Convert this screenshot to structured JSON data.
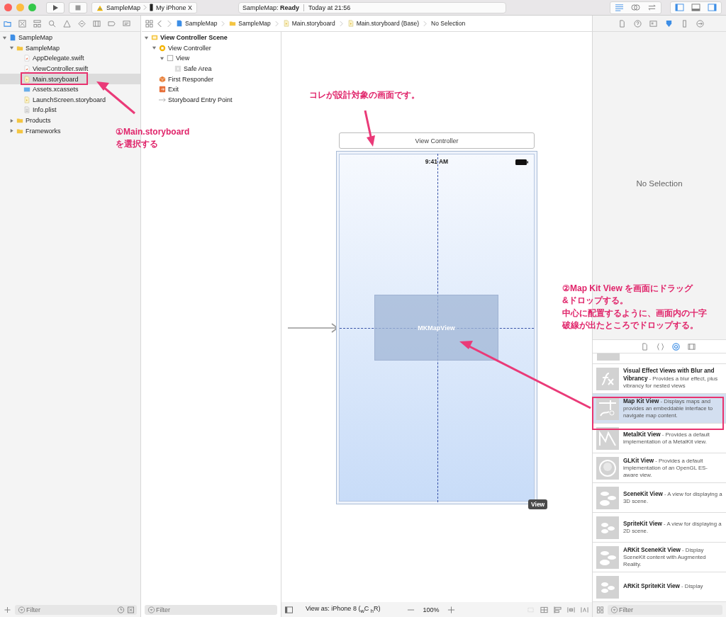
{
  "toolbar": {
    "scheme": "SampleMap",
    "device": "My iPhone X",
    "status": "SampleMap: **Ready**",
    "time": "Today at 21:56"
  },
  "jump_bar": [
    {
      "kind": "project",
      "label": "SampleMap"
    },
    {
      "kind": "folder",
      "label": "SampleMap"
    },
    {
      "kind": "storyboard",
      "label": "Main.storyboard"
    },
    {
      "kind": "storyboard",
      "label": "Main.storyboard (Base)"
    },
    {
      "kind": "none",
      "label": "No Selection"
    }
  ],
  "navigator": {
    "items": [
      {
        "kind": "project",
        "label": "SampleMap",
        "selected": false,
        "expanded": true,
        "children": [
          {
            "kind": "folder",
            "label": "SampleMap",
            "selected": false,
            "expanded": true,
            "children": [
              {
                "kind": "swift",
                "label": "AppDelegate.swift",
                "selected": false
              },
              {
                "kind": "swift",
                "label": "ViewController.swift",
                "selected": false
              },
              {
                "kind": "storyboard",
                "label": "Main.storyboard",
                "selected": true
              },
              {
                "kind": "assets",
                "label": "Assets.xcassets",
                "selected": false
              },
              {
                "kind": "storyboard",
                "label": "LaunchScreen.storyboard",
                "selected": false
              },
              {
                "kind": "plist",
                "label": "Info.plist",
                "selected": false
              }
            ]
          },
          {
            "kind": "folder",
            "label": "Products",
            "selected": false,
            "expanded": false
          },
          {
            "kind": "folder",
            "label": "Frameworks",
            "selected": false,
            "expanded": false
          }
        ]
      }
    ],
    "filter_placeholder": "Filter"
  },
  "outline": {
    "items": [
      {
        "kind": "scene",
        "label": "View Controller Scene",
        "expanded": true,
        "children": [
          {
            "kind": "controller",
            "label": "View Controller",
            "expanded": true,
            "children": [
              {
                "kind": "view",
                "label": "View",
                "expanded": true,
                "children": [
                  {
                    "kind": "safe-area",
                    "label": "Safe Area"
                  }
                ]
              }
            ]
          },
          {
            "kind": "responder",
            "label": "First Responder"
          },
          {
            "kind": "exit",
            "label": "Exit"
          },
          {
            "kind": "entry",
            "label": "Storyboard Entry Point"
          }
        ]
      }
    ],
    "filter_placeholder": "Filter"
  },
  "canvas": {
    "scene_title": "View Controller",
    "status_time": "9:41 AM",
    "map_view": "MKMapView",
    "view_badge": "View",
    "view_as": "View as: iPhone 8 ($_{w}$C $_{h}$R)",
    "zoom": "100%"
  },
  "inspector": {
    "empty_text": "No Selection"
  },
  "library": {
    "items": [
      {
        "kind": "blur",
        "text": "**Visual Effect Views with Blur and Vibrancy** - Provides a blur effect, plus vibrancy for nested views",
        "selected": false
      },
      {
        "kind": "map",
        "text": "**Map Kit View** - Displays maps and provides an embeddable interface to navigate map content.",
        "selected": true
      },
      {
        "kind": "metal",
        "text": "**MetalKit View** - Provides a default implementation of a MetalKit view.",
        "selected": false
      },
      {
        "kind": "gl",
        "text": "**GLKit View** - Provides a default implementation of an OpenGL ES-aware view.",
        "selected": false
      },
      {
        "kind": "scene",
        "text": "**SceneKit View** - A view for displaying a 3D scene.",
        "selected": false
      },
      {
        "kind": "sprite",
        "text": "**SpriteKit View** - A view for displaying a 2D scene.",
        "selected": false
      },
      {
        "kind": "arscene",
        "text": "**ARKit SceneKit View** - Display SceneKit content with Augmented Reality.",
        "selected": false
      },
      {
        "kind": "arsprite",
        "text": "**ARKit SpriteKit View** - Display",
        "selected": false
      }
    ],
    "filter_placeholder": "Filter"
  },
  "annotations": [
    {
      "lines": [
        "コレが設計対象の画面です。"
      ]
    },
    {
      "lines": [
        "①Main.storyboard",
        "を選択する"
      ]
    },
    {
      "lines": [
        "②Map Kit View を画面にドラッグ",
        "&ドロップする。",
        "中心に配置するように、画面内の十字",
        "破線が出たところでドロップする。"
      ]
    }
  ]
}
